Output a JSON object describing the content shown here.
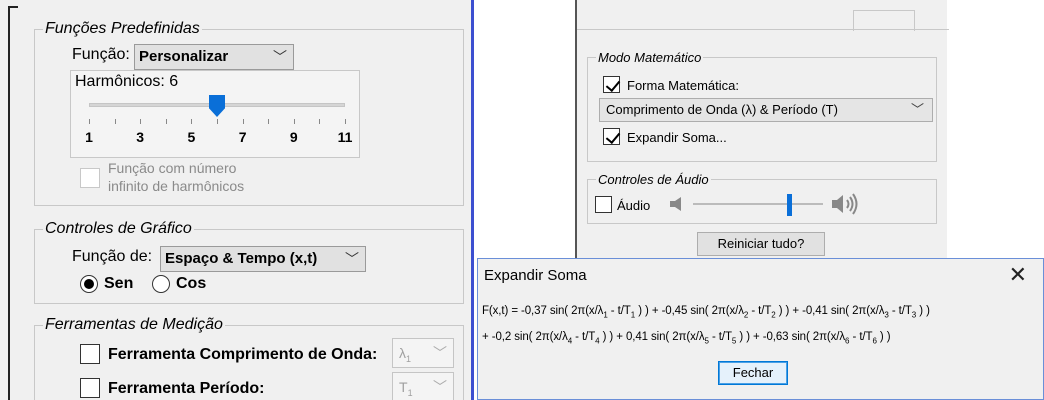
{
  "predefined_functions": {
    "legend": "Funções Predefinidas",
    "function_label": "Função:",
    "function_value": "Personalizar",
    "harmonics_label": "Harmônicos: 6",
    "harmonics_value": 6,
    "harmonics_range": [
      1,
      11
    ],
    "tick_labels": [
      "1",
      "3",
      "5",
      "7",
      "9",
      "11"
    ],
    "infinite_label_1": "Função com número",
    "infinite_label_2": "infinito de harmônicos",
    "infinite_checked": false
  },
  "graph_controls": {
    "legend": "Controles de Gráfico",
    "function_of_label": "Função de:",
    "function_of_value": "Espaço & Tempo (x,t)",
    "sin_label": "Sen",
    "cos_label": "Cos",
    "selected": "Sen"
  },
  "measurement_tools": {
    "legend": "Ferramentas de Medição",
    "wavelength_tool_label": "Ferramenta Comprimento de Onda:",
    "wavelength_select": "λ",
    "wavelength_select_sub": "1",
    "period_tool_label": "Ferramenta Período:",
    "period_select": "T",
    "period_select_sub": "1"
  },
  "math_mode": {
    "legend": "Modo Matemático",
    "math_form_label": "Forma Matemática:",
    "math_form_checked": true,
    "math_form_value": "Comprimento de Onda (λ) & Período (T)",
    "expand_sum_label": "Expandir Soma...",
    "expand_sum_checked": true
  },
  "audio_controls": {
    "legend": "Controles de Áudio",
    "audio_label": "Áudio",
    "audio_checked": false,
    "volume_level": 0.72
  },
  "reset_button": "Reiniciar tudo?",
  "dialog": {
    "title": "Expandir Soma",
    "close_symbol": "✕",
    "close_button": "Fechar",
    "terms": [
      {
        "prefix": "F(x,t) = ",
        "coef": "-0,37",
        "n": "1",
        "sep": " + "
      },
      {
        "prefix": "",
        "coef": "-0,45",
        "n": "2",
        "sep": " + "
      },
      {
        "prefix": "",
        "coef": "-0,41",
        "n": "3",
        "sep": ""
      },
      {
        "prefix": "+ ",
        "coef": "-0,2",
        "n": "4",
        "sep": " + "
      },
      {
        "prefix": "",
        "coef": "0,41",
        "n": "5",
        "sep": " + "
      },
      {
        "prefix": "",
        "coef": "-0,63",
        "n": "6",
        "sep": ""
      }
    ]
  },
  "colors": {
    "accent": "#0a6fd8",
    "panel_border": "#3c4fd0",
    "panel_bg": "#f0f0f0"
  }
}
